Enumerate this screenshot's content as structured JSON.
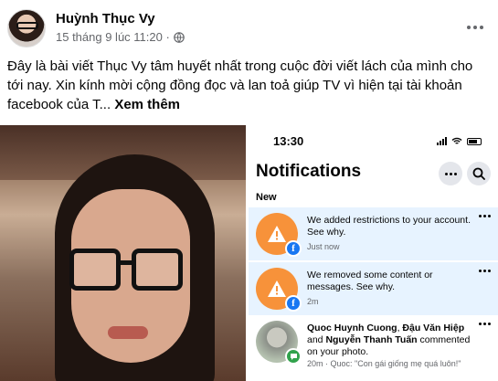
{
  "post": {
    "author": "Huỳnh Thục Vy",
    "timestamp": "15 tháng 9 lúc 11:20 ·",
    "privacy_icon": "globe-icon",
    "text": "Đây là bài viết Thục Vy tâm huyết nhất trong cuộc đời viết lách của mình cho tới nay. Xin kính mời cộng đồng đọc và lan toả giúp TV vì hiện tại tài khoản facebook của T... ",
    "see_more": "Xem thêm"
  },
  "phone": {
    "time": "13:30",
    "title": "Notifications",
    "section_label": "New",
    "notifications": [
      {
        "text": "We added restrictions to your account. See why.",
        "time": "Just now",
        "icon": "warning-icon",
        "badge": "facebook-icon"
      },
      {
        "text": "We removed some content or messages. See why.",
        "time": "2m",
        "icon": "warning-icon",
        "badge": "facebook-icon"
      },
      {
        "names_1": "Quoc Huynh Cuong",
        "sep_1": ", ",
        "names_2": "Đậu Văn Hiệp",
        "sep_2": " and ",
        "names_3": "Nguyễn Thanh Tuấn",
        "action": " commented on your photo.",
        "time": "20m · Quoc: \"Con gái giống mẹ quá luôn!\"",
        "badge": "comment-icon"
      }
    ]
  },
  "colors": {
    "unread_bg": "#e7f3ff",
    "warning_orange": "#f7923a",
    "facebook_blue": "#1877f2",
    "comment_green": "#31a24c"
  }
}
